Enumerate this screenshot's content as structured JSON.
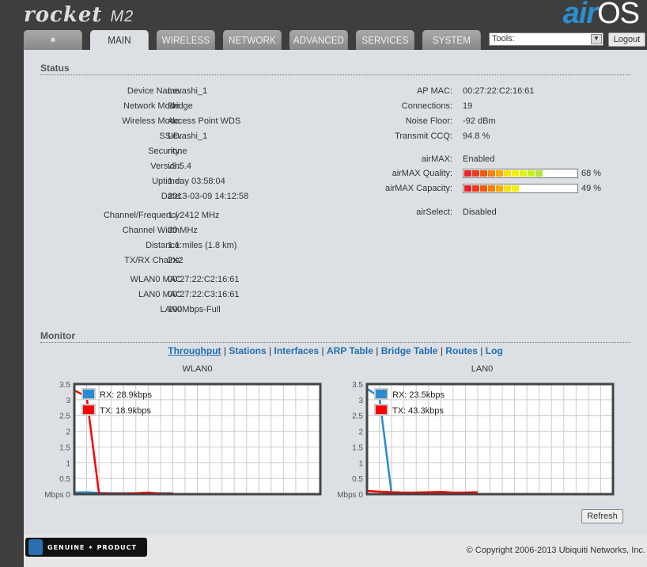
{
  "header": {
    "product": "rocket",
    "model": "M2",
    "brand_air": "air",
    "brand_os": "OS"
  },
  "tabs": [
    {
      "label": ""
    },
    {
      "label": "MAIN"
    },
    {
      "label": "WIRELESS"
    },
    {
      "label": "NETWORK"
    },
    {
      "label": "ADVANCED"
    },
    {
      "label": "SERVICES"
    },
    {
      "label": "SYSTEM"
    }
  ],
  "tools": {
    "selected": "Tools:",
    "logout": "Logout"
  },
  "status": {
    "title": "Status",
    "left": [
      [
        "Device Name:",
        "Levashi_1"
      ],
      [
        "Network Mode:",
        "Bridge"
      ],
      [
        "Wireless Mode:",
        "Access Point WDS"
      ],
      [
        "SSID:",
        "Levashi_1"
      ],
      [
        "Security:",
        "none"
      ],
      [
        "Version:",
        "v5.5.4"
      ],
      [
        "Uptime:",
        "1 day 03:58:04"
      ],
      [
        "Date:",
        "2013-03-09 14:12:58"
      ],
      [
        "Channel/Frequency:",
        "1 / 2412 MHz"
      ],
      [
        "Channel Width:",
        "20 MHz"
      ],
      [
        "Distance:",
        "1.1 miles (1.8 km)"
      ],
      [
        "TX/RX Chains:",
        "2X2"
      ],
      [
        "WLAN0 MAC",
        "00:27:22:C2:16:61"
      ],
      [
        "LAN0 MAC",
        "00:27:22:C3:16:61"
      ],
      [
        "LAN0",
        "100Mbps-Full"
      ]
    ],
    "right": [
      [
        "AP MAC:",
        "00:27:22:C2:16:61"
      ],
      [
        "Connections:",
        "19"
      ],
      [
        "Noise Floor:",
        "-92 dBm"
      ],
      [
        "Transmit CCQ:",
        "94.8 %"
      ],
      [
        "airMAX:",
        "Enabled"
      ],
      [
        "airMAX Quality:",
        ""
      ],
      [
        "airMAX Capacity:",
        ""
      ],
      [
        "airSelect:",
        "Disabled"
      ]
    ],
    "airmax_quality": {
      "percent": 68,
      "text": "68 %"
    },
    "airmax_capacity": {
      "percent": 49,
      "text": "49 %"
    }
  },
  "monitor": {
    "title": "Monitor",
    "links": [
      "Throughput",
      "Stations",
      "Interfaces",
      "ARP Table",
      "Bridge Table",
      "Routes",
      "Log"
    ],
    "active_link": "Throughput",
    "refresh": "Refresh"
  },
  "chart_data": [
    {
      "type": "line",
      "title": "WLAN0",
      "ylabel": "Mbps",
      "ylim": [
        0,
        3.5
      ],
      "yticks": [
        "0",
        "0.5",
        "1",
        "1.5",
        "2",
        "2.5",
        "3",
        "3.5"
      ],
      "grid": true,
      "legend": "top-left",
      "series": [
        {
          "name": "RX: 28.9kbps",
          "color": "#2a8bd0",
          "values": [
            0.05,
            0.06,
            0.04,
            0.03,
            0.03,
            0.03,
            0.03,
            0.03,
            0.03
          ]
        },
        {
          "name": "TX: 18.9kbps",
          "color": "#ff0000",
          "values": [
            3.3,
            3.1,
            0.03,
            0.02,
            0.02,
            0.03,
            0.05,
            0.02,
            0.02
          ]
        }
      ]
    },
    {
      "type": "line",
      "title": "LAN0",
      "ylabel": "Mbps",
      "ylim": [
        0,
        3.5
      ],
      "yticks": [
        "0",
        "0.5",
        "1",
        "1.5",
        "2",
        "2.5",
        "3",
        "3.5"
      ],
      "grid": true,
      "legend": "top-left",
      "series": [
        {
          "name": "RX: 23.5kbps",
          "color": "#2a8bd0",
          "values": [
            3.35,
            3.1,
            0.02,
            0.02,
            0.02,
            0.02,
            0.02,
            0.02,
            0.02,
            0.02
          ]
        },
        {
          "name": "TX: 43.3kbps",
          "color": "#ff0000",
          "values": [
            0.1,
            0.08,
            0.06,
            0.05,
            0.05,
            0.06,
            0.07,
            0.05,
            0.05,
            0.06
          ]
        }
      ]
    }
  ],
  "footer": {
    "genuine": "GENUINE",
    "product": "PRODUCT",
    "copyright": "© Copyright 2006-2013 Ubiquiti Networks, Inc."
  }
}
